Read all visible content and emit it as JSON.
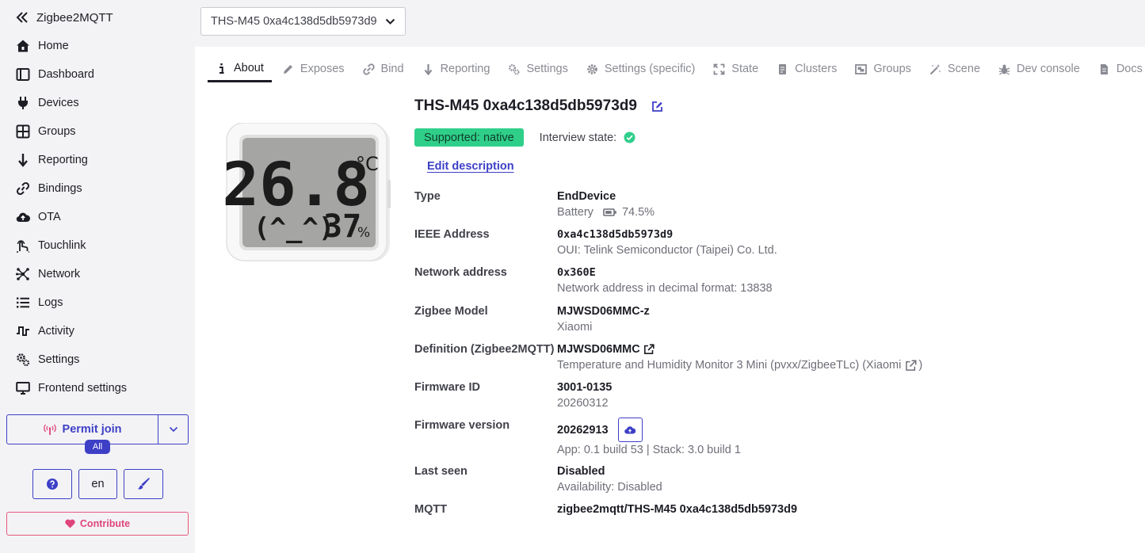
{
  "sidebar": {
    "brand": "Zigbee2MQTT",
    "items": [
      {
        "label": "Home",
        "icon": "home-icon"
      },
      {
        "label": "Dashboard",
        "icon": "dashboard-icon"
      },
      {
        "label": "Devices",
        "icon": "plug-icon"
      },
      {
        "label": "Groups",
        "icon": "grid-icon"
      },
      {
        "label": "Reporting",
        "icon": "arrow-down-icon"
      },
      {
        "label": "Bindings",
        "icon": "link-icon"
      },
      {
        "label": "OTA",
        "icon": "cloud-upload-icon"
      },
      {
        "label": "Touchlink",
        "icon": "touchlink-icon"
      },
      {
        "label": "Network",
        "icon": "network-icon"
      },
      {
        "label": "Logs",
        "icon": "list-icon"
      },
      {
        "label": "Activity",
        "icon": "activity-icon"
      },
      {
        "label": "Settings",
        "icon": "gears-icon"
      },
      {
        "label": "Frontend settings",
        "icon": "monitor-icon"
      }
    ],
    "permit_join": "Permit join",
    "permit_badge": "All",
    "language": "en",
    "contribute": "Contribute"
  },
  "device_select": {
    "value": "THS-M45 0xa4c138d5db5973d9"
  },
  "tabs": [
    {
      "label": "About",
      "icon": "info-icon",
      "active": true
    },
    {
      "label": "Exposes",
      "icon": "pencil-icon"
    },
    {
      "label": "Bind",
      "icon": "link-icon"
    },
    {
      "label": "Reporting",
      "icon": "arrow-down-icon"
    },
    {
      "label": "Settings",
      "icon": "gears-icon"
    },
    {
      "label": "Settings (specific)",
      "icon": "gear-icon"
    },
    {
      "label": "State",
      "icon": "expand-icon"
    },
    {
      "label": "Clusters",
      "icon": "file-icon"
    },
    {
      "label": "Groups",
      "icon": "object-group-icon"
    },
    {
      "label": "Scene",
      "icon": "wand-icon"
    },
    {
      "label": "Dev console",
      "icon": "bug-icon"
    },
    {
      "label": "Docs",
      "icon": "doc-icon"
    }
  ],
  "device": {
    "title": "THS-M45 0xa4c138d5db5973d9",
    "supported": "Supported: native",
    "interview_label": "Interview state:",
    "edit_description": "Edit description",
    "display": {
      "temperature": "26.8",
      "unit": "°C",
      "face": "(^_^)",
      "humidity": "37",
      "humidity_unit": "%"
    },
    "rows": {
      "type": {
        "label": "Type",
        "value": "EndDevice",
        "sub_label": "Battery",
        "sub_value": "74.5%"
      },
      "ieee": {
        "label": "IEEE Address",
        "value": "0xa4c138d5db5973d9",
        "sub": "OUI: Telink Semiconductor (Taipei) Co. Ltd."
      },
      "network": {
        "label": "Network address",
        "value": "0x360E",
        "sub": "Network address in decimal format: 13838"
      },
      "model": {
        "label": "Zigbee Model",
        "value": "MJWSD06MMC-z",
        "sub": "Xiaomi"
      },
      "definition": {
        "label": "Definition (Zigbee2MQTT)",
        "value": "MJWSD06MMC",
        "sub": "Temperature and Humidity Monitor 3 Mini (pvxx/ZigbeeTLc) (Xiaomi",
        "sub_close": ")"
      },
      "firmware_id": {
        "label": "Firmware ID",
        "value": "3001-0135",
        "sub": "20260312"
      },
      "firmware_version": {
        "label": "Firmware version",
        "value": "20262913",
        "sub": "App: 0.1 build 53 | Stack: 3.0 build 1"
      },
      "last_seen": {
        "label": "Last seen",
        "value": "Disabled",
        "sub": "Availability: Disabled"
      },
      "mqtt": {
        "label": "MQTT",
        "value": "zigbee2mqtt/THS-M45 0xa4c138d5db5973d9"
      }
    }
  },
  "colors": {
    "accent": "#3d3fc7",
    "success": "#2fcf8a",
    "contribute": "#e0457a"
  }
}
